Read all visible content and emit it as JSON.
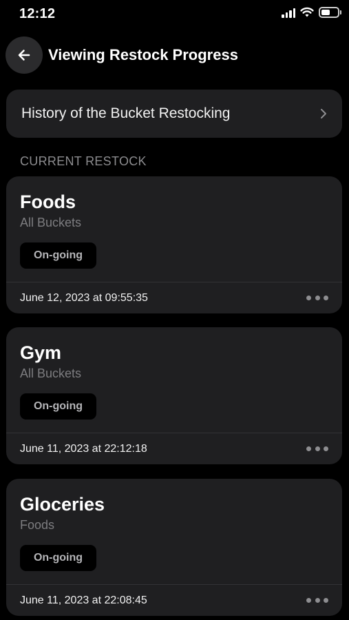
{
  "status_bar": {
    "time": "12:12",
    "icons": [
      "cellular-signal-icon",
      "wifi-icon",
      "battery-icon"
    ]
  },
  "header": {
    "back_icon": "arrow-left-icon",
    "title": "Viewing Restock Progress"
  },
  "history": {
    "label": "History of the Bucket Restocking",
    "icon": "chevron-right-icon"
  },
  "section": {
    "title": "CURRENT RESTOCK"
  },
  "restocks": [
    {
      "title": "Foods",
      "subtitle": "All Buckets",
      "status": "On-going",
      "date": "June 12, 2023 at 09:55:35"
    },
    {
      "title": "Gym",
      "subtitle": "All Buckets",
      "status": "On-going",
      "date": "June 11, 2023 at 22:12:18"
    },
    {
      "title": "Gloceries",
      "subtitle": "Foods",
      "status": "On-going",
      "date": "June 11, 2023 at 22:08:45"
    }
  ],
  "colors": {
    "background": "#000000",
    "card": "#1f1f21",
    "secondary_text": "#7d7d80",
    "section_text": "#8c8c8f",
    "badge_bg": "#000000",
    "badge_text": "#b5b5b8"
  }
}
